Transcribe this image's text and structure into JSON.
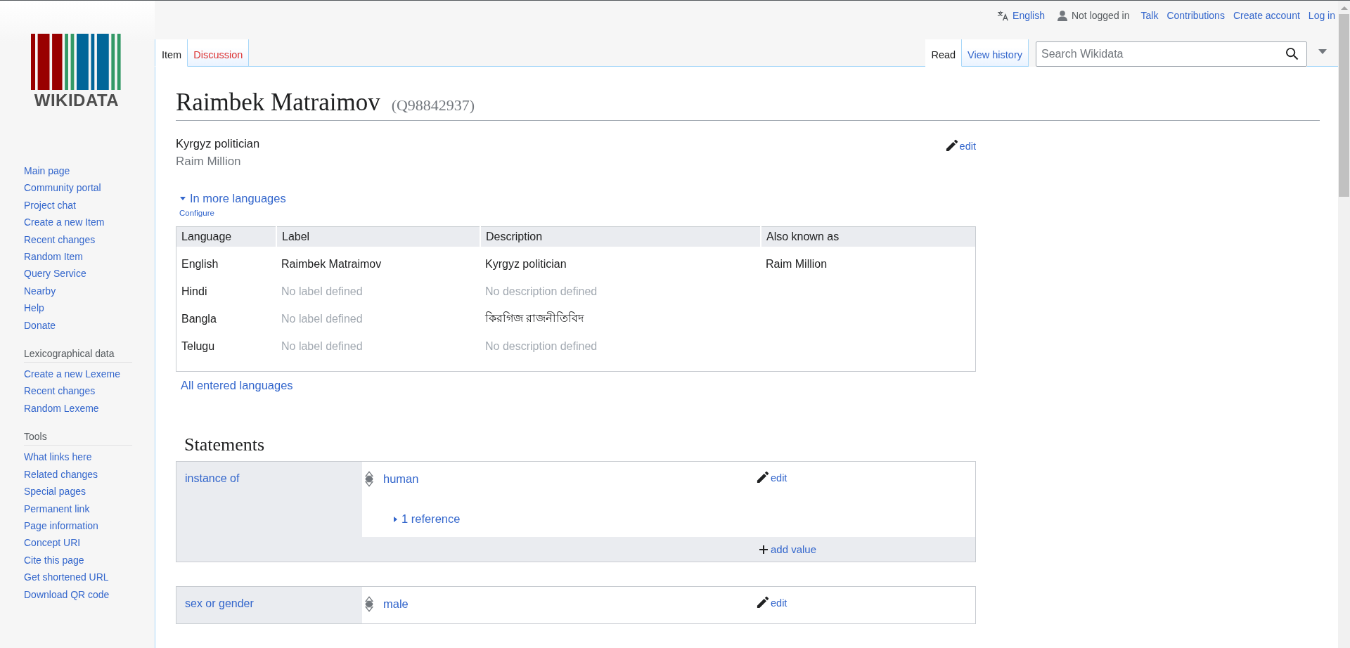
{
  "personal": {
    "language": "English",
    "user_status": "Not logged in",
    "links": [
      "Talk",
      "Contributions",
      "Create account",
      "Log in"
    ]
  },
  "logo": {
    "wordmark": "WIKIDATA"
  },
  "sidebar": {
    "sections": [
      {
        "items": [
          "Main page",
          "Community portal",
          "Project chat",
          "Create a new Item",
          "Recent changes",
          "Random Item",
          "Query Service",
          "Nearby",
          "Help",
          "Donate"
        ]
      },
      {
        "heading": "Lexicographical data",
        "items": [
          "Create a new Lexeme",
          "Recent changes",
          "Random Lexeme"
        ]
      },
      {
        "heading": "Tools",
        "items": [
          "What links here",
          "Related changes",
          "Special pages",
          "Permanent link",
          "Page information",
          "Concept URI",
          "Cite this page",
          "Get shortened URL",
          "Download QR code"
        ]
      }
    ]
  },
  "tabs_left": [
    {
      "label": "Item",
      "selected": true,
      "redlink": false
    },
    {
      "label": "Discussion",
      "selected": false,
      "redlink": true
    }
  ],
  "tabs_right": [
    {
      "label": "Read",
      "selected": true,
      "redlink": false
    },
    {
      "label": "View history",
      "selected": false,
      "redlink": false
    }
  ],
  "search": {
    "placeholder": "Search Wikidata"
  },
  "heading": {
    "label": "Raimbek Matraimov",
    "id": "(Q98842937)"
  },
  "description": "Kyrgyz politician",
  "aliases": [
    "Raim Million"
  ],
  "edit_link": "edit",
  "languages": {
    "toggle": "In more languages",
    "expanded": true,
    "configure": "Configure",
    "columns": [
      "Language",
      "Label",
      "Description",
      "Also known as"
    ],
    "rows": [
      {
        "language": "English",
        "label": "Raimbek Matraimov",
        "label_missing": false,
        "description": "Kyrgyz politician",
        "description_missing": false,
        "aliases": "Raim Million"
      },
      {
        "language": "Hindi",
        "label": "No label defined",
        "label_missing": true,
        "description": "No description defined",
        "description_missing": true
      },
      {
        "language": "Bangla",
        "label": "No label defined",
        "label_missing": true,
        "description": "কিরগিজ রাজনীতিবিদ",
        "description_missing": false
      },
      {
        "language": "Telugu",
        "label": "No label defined",
        "label_missing": true,
        "description": "No description defined",
        "description_missing": true
      }
    ],
    "all_link": "All entered languages"
  },
  "statements": {
    "title": "Statements",
    "groups": [
      {
        "property": "instance of",
        "values": [
          {
            "value": "human",
            "edit": "edit",
            "references": "1 reference"
          }
        ],
        "add_value": "add value"
      },
      {
        "property": "sex or gender",
        "values": [
          {
            "value": "male",
            "edit": "edit"
          }
        ]
      }
    ]
  }
}
